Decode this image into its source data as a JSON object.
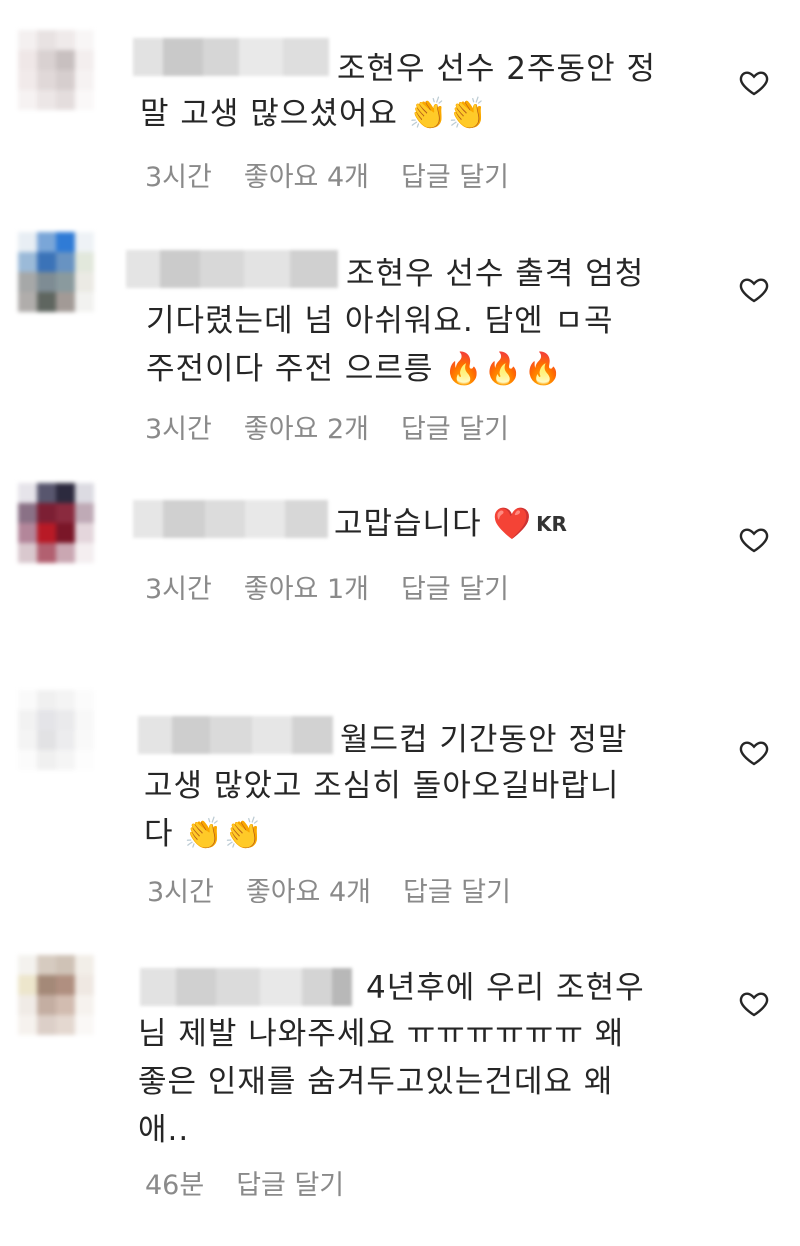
{
  "comments": [
    {
      "lines": [
        "조현우 선수 2주동안 정",
        "말 고생 많으셨어요 👏👏"
      ],
      "time": "3시간",
      "likes": "좋아요 4개",
      "reply": "답글 달기"
    },
    {
      "lines": [
        "조현우 선수 출격 엄청",
        "기다렸는데 넘 아쉬워요. 담엔 ㅁ곡",
        "주전이다 주전 으르릉 🔥🔥🔥"
      ],
      "time": "3시간",
      "likes": "좋아요 2개",
      "reply": "답글 달기"
    },
    {
      "lines": [
        "고맙습니다 ❤️"
      ],
      "flag": "KR",
      "time": "3시간",
      "likes": "좋아요 1개",
      "reply": "답글 달기"
    },
    {
      "lines": [
        "월드컵 기간동안 정말",
        "고생 많았고 조심히 돌아오길바랍니",
        "다 👏👏"
      ],
      "time": "3시간",
      "likes": "좋아요 4개",
      "reply": "답글 달기"
    },
    {
      "lines": [
        "4년후에 우리 조현우",
        "님 제발 나와주세요 ㅠㅠㅠㅠㅠㅠ 왜",
        "좋은 인재를 숨겨두고있는건데요 왜",
        "애.."
      ],
      "time": "46분",
      "reply": "답글 달기"
    }
  ],
  "icons": {
    "like": "heart-outline-icon"
  },
  "colors": {
    "meta": "#8a8a8a",
    "text": "#262626"
  }
}
